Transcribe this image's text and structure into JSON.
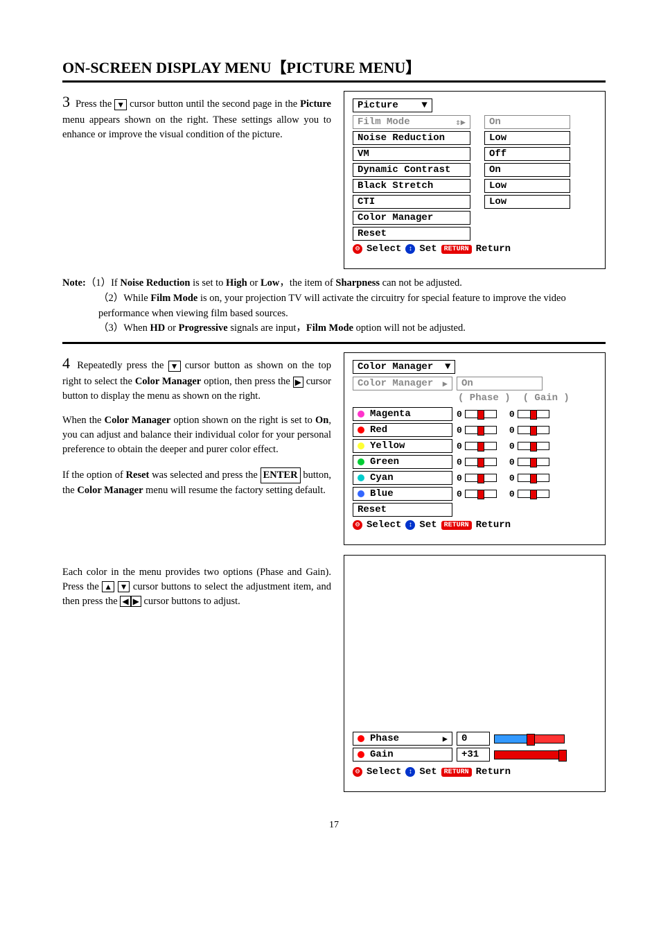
{
  "title": "ON-SCREEN DISPLAY MENU【PICTURE MENU】",
  "step3": {
    "num": "3",
    "text_a": " Press the ",
    "text_b": " cursor button until the second page in the ",
    "text_c": "Picture",
    "text_d": " menu appears shown on the right. These settings allow you to enhance or improve the visual condition of the picture."
  },
  "osd1": {
    "header": "Picture",
    "rows": [
      {
        "label": "Film Mode",
        "value": "On",
        "gray": true,
        "arrow": true
      },
      {
        "label": "Noise Reduction",
        "value": "Low"
      },
      {
        "label": "VM",
        "value": "Off"
      },
      {
        "label": "Dynamic Contrast",
        "value": "On"
      },
      {
        "label": "Black Stretch",
        "value": "Low"
      },
      {
        "label": "CTI",
        "value": "Low"
      },
      {
        "label": "Color Manager",
        "value": ""
      },
      {
        "label": "Reset",
        "value": ""
      }
    ],
    "footer": {
      "select": "Select",
      "set": "Set",
      "returnpill": "RETURN",
      "return": "Return"
    }
  },
  "notes": {
    "lead": "Note:",
    "n1a": "（1）If ",
    "n1b": "Noise Reduction",
    "n1c": " is set to ",
    "n1d": "High",
    "n1e": " or ",
    "n1f": "Low",
    "n1g": "，the item of ",
    "n1h": "Sharpness",
    "n1i": " can not be adjusted.",
    "n2a": "（2）While ",
    "n2b": "Film Mode",
    "n2c": " is on, your projection TV will activate the circuitry for special feature to improve the video performance when viewing film based sources.",
    "n3a": "（3）When ",
    "n3b": "HD",
    "n3c": " or ",
    "n3d": "Progressive",
    "n3e": " signals are input，",
    "n3f": "Film Mode",
    "n3g": " option will not be adjusted."
  },
  "step4": {
    "num": "4",
    "t1": " Repeatedly press the ",
    "t2": " cursor button as shown on the top right to select the ",
    "t3": "Color Manager",
    "t4": " option, then press the ",
    "t5": " cursor button to display the menu as shown on the right.",
    "p2a": "When the ",
    "p2b": "Color Manager",
    "p2c": " option shown on the right is set to ",
    "p2d": "On",
    "p2e": ", you can adjust and balance their individual color for your personal preference to obtain the deeper and purer color effect.",
    "p3a": "If the option of ",
    "p3b": "Reset",
    "p3c": " was selected and press the ",
    "p3d": "ENTER",
    "p3e": " button, the ",
    "p3f": "Color Manager",
    "p3g": " menu will resume the factory setting default.",
    "p4a": "Each color in the menu provides two options (Phase and Gain). Press the ",
    "p4b": " cursor buttons to select the adjustment item, and then press the ",
    "p4c": " cursor buttons to adjust."
  },
  "osd2": {
    "header": "Color Manager",
    "subheader": "Color Manager",
    "subvalue": "On",
    "pg": {
      "phase": "( Phase )",
      "gain": "( Gain )"
    },
    "rows": [
      {
        "dot": "magenta",
        "label": "Magenta"
      },
      {
        "dot": "red",
        "label": "Red"
      },
      {
        "dot": "yellow",
        "label": "Yellow"
      },
      {
        "dot": "green",
        "label": "Green"
      },
      {
        "dot": "cyan",
        "label": "Cyan"
      },
      {
        "dot": "blue",
        "label": "Blue"
      }
    ],
    "reset": "Reset",
    "footer": {
      "select": "Select",
      "set": "Set",
      "returnpill": "RETURN",
      "return": "Return"
    }
  },
  "osd3": {
    "rows": [
      {
        "dot": "red",
        "label": "Phase",
        "value": "0",
        "type": "bicolor",
        "arrow": true
      },
      {
        "dot": "red",
        "label": "Gain",
        "value": "+31",
        "type": "fill"
      }
    ],
    "footer": {
      "select": "Select",
      "set": "Set",
      "returnpill": "RETURN",
      "return": "Return"
    }
  },
  "page_number": "17"
}
